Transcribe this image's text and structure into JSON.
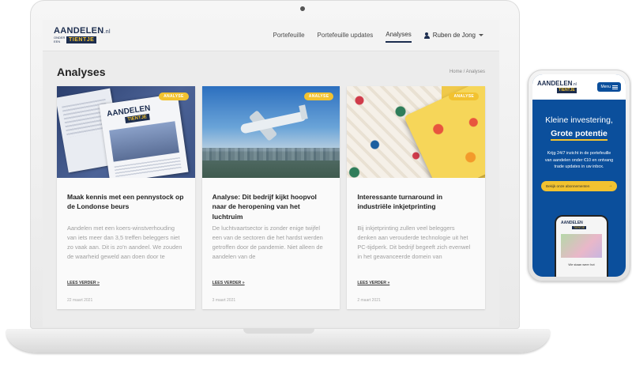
{
  "laptop": {
    "site": {
      "logo": {
        "main": "AANDELEN",
        "tld": ".nl",
        "small": "ONDER EEN",
        "badge": "TIENTJE"
      },
      "nav": [
        {
          "label": "Portefeuille"
        },
        {
          "label": "Portefeuille updates"
        },
        {
          "label": "Analyses",
          "active": true
        }
      ],
      "user": {
        "name": "Ruben de Jong"
      },
      "page_title": "Analyses",
      "breadcrumb": "Home / Analyses",
      "cards": [
        {
          "tag": "ANALYSE",
          "title": "Maak kennis met een pennystock op de Londonse beurs",
          "text": "Aandelen met een koers-winstverhouding van iets meer dan 3,5 treffen beleggers niet zo vaak aan. Dit is zo'n aandeel. We zouden de waarheid geweld aan doen door te",
          "read_more": "LEES VERDER »",
          "date": "22 maart 2021",
          "magazine_logo": "AANDELEN",
          "magazine_badge": "TIENTJE"
        },
        {
          "tag": "ANALYSE",
          "title": "Analyse: Dit bedrijf kijkt hoopvol naar de heropening van het luchtruim",
          "text": "De luchtvaartsector is zonder enige twijfel een van de sectoren die het hardst werden getroffen door de pandemie. Niet alleen de aandelen van de",
          "read_more": "LEES VERDER »",
          "date": "3 maart 2021"
        },
        {
          "tag": "ANALYSE",
          "title": "Interessante turnaround in industriële inkjetprinting",
          "text": "Bij inkjetprinting zullen veel beleggers denken aan verouderde technologie uit het PC-tijdperk. Dit bedrijf begeeft zich evenwel in het geavanceerde domein van",
          "read_more": "LEES VERDER »",
          "date": "2 maart 2021"
        }
      ]
    }
  },
  "phone": {
    "logo": {
      "main": "AANDELEN",
      "tld": ".nl",
      "badge": "TIENTJE"
    },
    "menu_label": "Menu",
    "hero_line1": "Kleine investering,",
    "hero_line2": "Grote potentie",
    "hero_text": "Krijg 24/7 inzicht in de portefeuille van aandelen onder €10 en ontvang trade updates in uw inbox.",
    "cta": "Bekijk onze abonnementen",
    "mini_logo": "AANDELEN",
    "mini_badge": "TIENTJE",
    "mini_caption": "We staan weer hot"
  },
  "colors": {
    "navy": "#1c2d4f",
    "accent_yellow": "#f2c230",
    "phone_blue": "#0b4f9c"
  }
}
